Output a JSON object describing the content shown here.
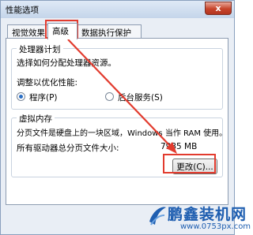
{
  "window": {
    "title": "性能选项",
    "close": "x"
  },
  "tabs": [
    {
      "label": "视觉效果"
    },
    {
      "label": "高级"
    },
    {
      "label": "数据执行保护"
    }
  ],
  "processor": {
    "title": "处理器计划",
    "desc": "选择如何分配处理器资源。",
    "optimize_label": "调整以优化性能:",
    "opt_programs": "程序(P)",
    "opt_services": "后台服务(S)"
  },
  "vm": {
    "title": "虚拟内存",
    "desc": "分页文件是硬盘上的一块区域，Windows 当作 RAM 使用。",
    "total_label": "所有驱动器总分页文件大小:",
    "total_value": "7935 MB",
    "change_button": "更改(C)..."
  },
  "watermark": {
    "name": "鹏鑫装机网",
    "url": "www.0753px.com"
  },
  "colors": {
    "highlight": "#e23b2e",
    "accent": "#1e5eb0"
  }
}
